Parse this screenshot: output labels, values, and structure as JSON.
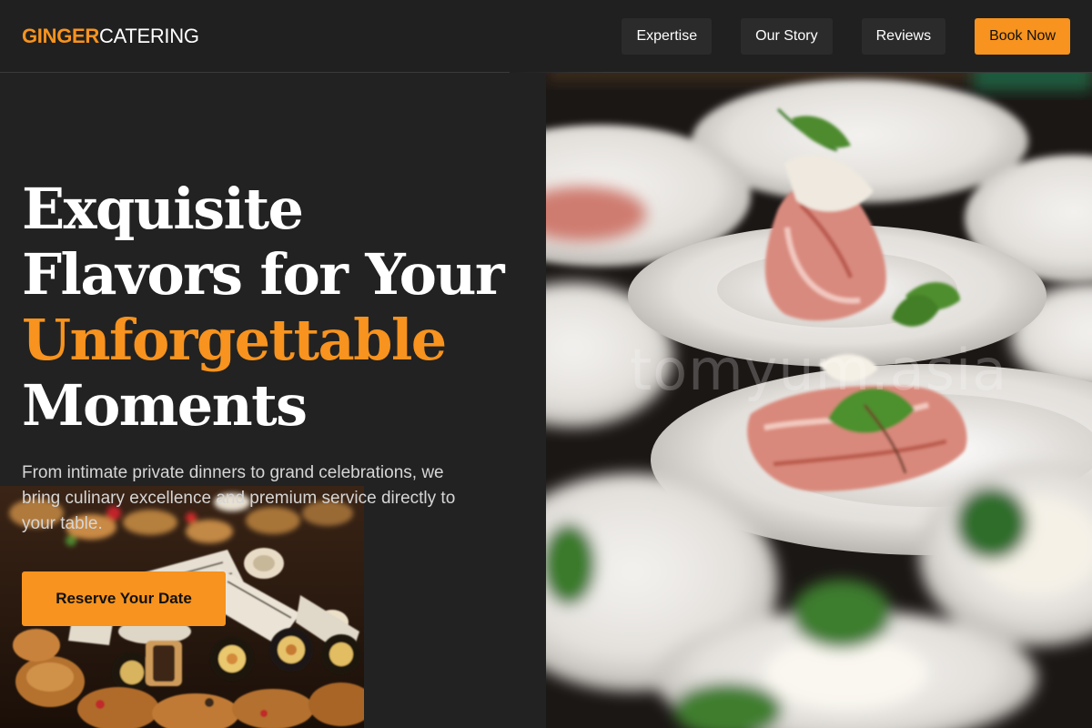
{
  "header": {
    "logo_accent": "GINGER",
    "logo_rest": "CATERING",
    "nav": [
      {
        "label": "Expertise"
      },
      {
        "label": "Our Story"
      },
      {
        "label": "Reviews"
      }
    ],
    "cta_label": "Book Now"
  },
  "hero": {
    "headline": {
      "line1": "Exquisite",
      "line2": "Flavors for Your",
      "line3": "Unforgettable",
      "line4": "Moments"
    },
    "subtitle": "From intimate private dinners to grand celebrations, we bring culinary excellence and premium service directly to your table.",
    "cta_label": "Reserve Your Date",
    "watermark": "tomyum.asia"
  },
  "colors": {
    "accent": "#f7931e",
    "background": "#222222",
    "header_bg": "#202020",
    "text": "#ffffff",
    "muted_text": "#d6d6d6"
  }
}
